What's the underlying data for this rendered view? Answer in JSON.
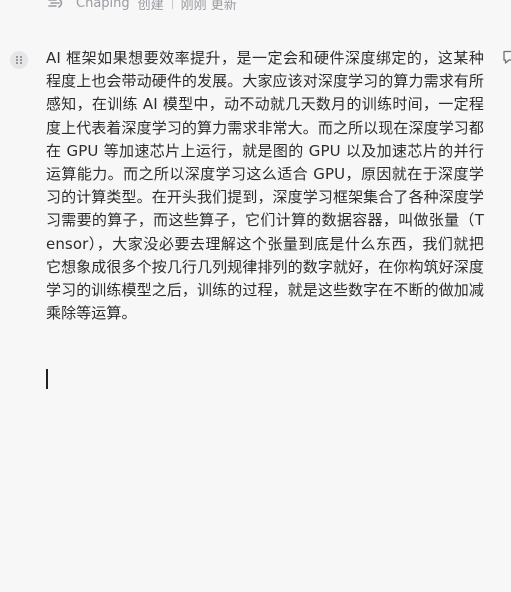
{
  "header": {
    "app_name": "Chaping",
    "action_label": "创建",
    "time_label": "刚刚 更新"
  },
  "icons": {
    "logo": "chaping-logo-icon",
    "drag": "drag-handle-icon",
    "comment": "comment-icon"
  },
  "document": {
    "paragraph": "AI 框架如果想要效率提升，是一定会和硬件深度绑定的，这某种程度上也会带动硬件的发展。大家应该对深度学习的算力需求有所感知，在训练 AI 模型中，动不动就几天数月的训练时间，一定程度上代表着深度学习的算力需求非常大。而之所以现在深度学习都在 GPU 等加速芯片上运行，就是图的 GPU 以及加速芯片的并行运算能力。而之所以深度学习这么适合 GPU，原因就在于深度学习的计算类型。在开头我们提到，深度学习框架集合了各种深度学习需要的算子，而这些算子，它们计算的数据容器，叫做张量（Tensor），大家没必要去理解这个张量到底是什么东西，我们就把它想象成很多个按几行几列规律排列的数字就好，在你构筑好深度学习的训练模型之后，训练的过程，就是这些数字在不断的做加减乘除等运算。"
  },
  "colors": {
    "background": "#f7f7f8",
    "text": "#2d2d2d",
    "meta_text": "#9a9aa0"
  }
}
